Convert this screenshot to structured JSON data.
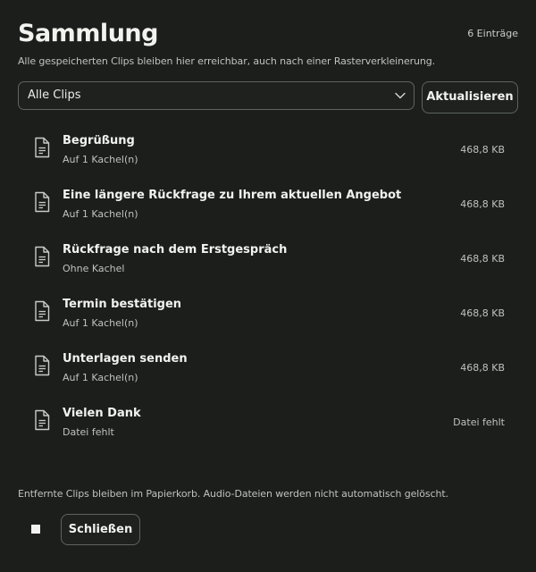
{
  "header": {
    "title": "Sammlung",
    "count": "6 Einträge",
    "subtitle": "Alle gespeicherten Clips bleiben hier erreichbar, auch nach einer Rasterverkleinerung."
  },
  "filter": {
    "selected": "Alle Clips",
    "icon": "chevron-down-icon"
  },
  "refresh_label": "Aktualisieren",
  "clips": [
    {
      "name": "Begrüßung",
      "meta": "Auf 1 Kachel(n)",
      "size": "468,8 KB",
      "icon": "document-icon"
    },
    {
      "name": "Eine längere Rückfrage zu Ihrem aktuellen Angebot",
      "meta": "Auf 1 Kachel(n)",
      "size": "468,8 KB",
      "icon": "document-icon"
    },
    {
      "name": "Rückfrage nach dem Erstgespräch",
      "meta": "Ohne Kachel",
      "size": "468,8 KB",
      "icon": "document-icon"
    },
    {
      "name": "Termin bestätigen",
      "meta": "Auf 1 Kachel(n)",
      "size": "468,8 KB",
      "icon": "document-icon"
    },
    {
      "name": "Unterlagen senden",
      "meta": "Auf 1 Kachel(n)",
      "size": "468,8 KB",
      "icon": "document-icon"
    },
    {
      "name": "Vielen Dank",
      "meta": "Datei fehlt",
      "size": "Datei fehlt",
      "icon": "document-icon"
    }
  ],
  "footer": {
    "note": "Entfernte Clips bleiben im Papierkorb. Audio-Dateien werden nicht automatisch gelöscht.",
    "close_label": "Schließen"
  },
  "colors": {
    "background": "#1b1e1b",
    "text": "#f2f2ee",
    "muted": "#bfc2bd",
    "border": "#5f645e"
  }
}
